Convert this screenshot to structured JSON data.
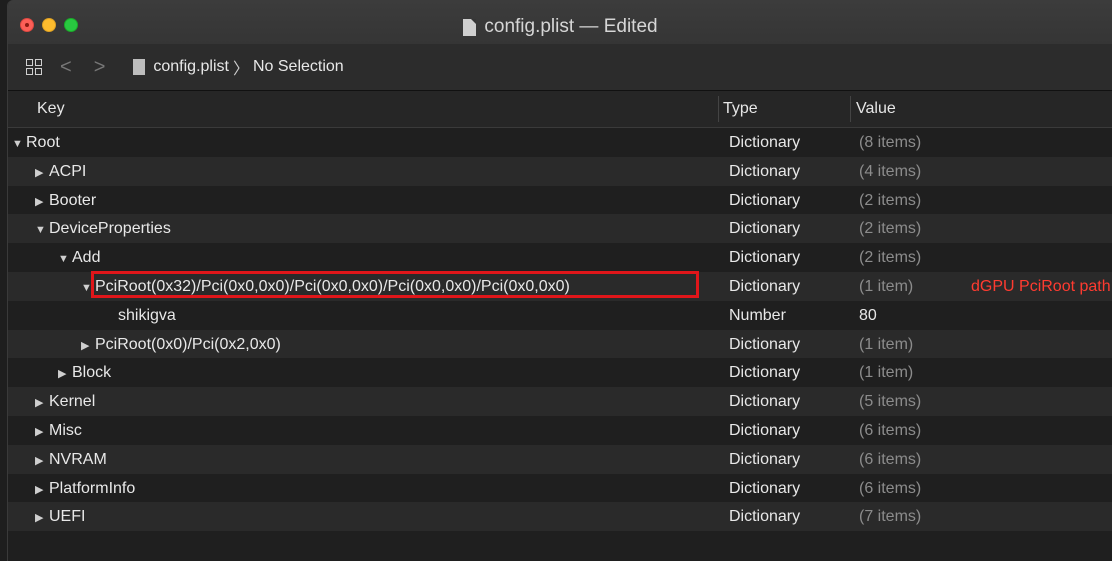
{
  "window": {
    "title": "config.plist — Edited"
  },
  "toolbar": {
    "file": "config.plist",
    "selection": "No Selection",
    "back_glyph": "<",
    "forward_glyph": ">",
    "separator_glyph": "〉"
  },
  "columns": {
    "key": "Key",
    "type": "Type",
    "value": "Value"
  },
  "rows": [
    {
      "key": "Root",
      "expander": "▼",
      "indent": 0,
      "type": "Dictionary",
      "value": "(8 items)"
    },
    {
      "key": "ACPI",
      "expander": "▶",
      "indent": 1,
      "type": "Dictionary",
      "value": "(4 items)"
    },
    {
      "key": "Booter",
      "expander": "▶",
      "indent": 1,
      "type": "Dictionary",
      "value": "(2 items)"
    },
    {
      "key": "DeviceProperties",
      "expander": "▼",
      "indent": 1,
      "type": "Dictionary",
      "value": "(2 items)"
    },
    {
      "key": "Add",
      "expander": "▼",
      "indent": 2,
      "type": "Dictionary",
      "value": "(2 items)"
    },
    {
      "key": "PciRoot(0x32)/Pci(0x0,0x0)/Pci(0x0,0x0)/Pci(0x0,0x0)/Pci(0x0,0x0)",
      "expander": "▼",
      "indent": 3,
      "type": "Dictionary",
      "value": "(1 item)",
      "note": "dGPU PciRoot path"
    },
    {
      "key": "shikigva",
      "expander": "",
      "indent": 4,
      "type": "Number",
      "value": "80",
      "bright": true
    },
    {
      "key": "PciRoot(0x0)/Pci(0x2,0x0)",
      "expander": "▶",
      "indent": 3,
      "type": "Dictionary",
      "value": "(1 item)"
    },
    {
      "key": "Block",
      "expander": "▶",
      "indent": 2,
      "type": "Dictionary",
      "value": "(1 item)"
    },
    {
      "key": "Kernel",
      "expander": "▶",
      "indent": 1,
      "type": "Dictionary",
      "value": "(5 items)"
    },
    {
      "key": "Misc",
      "expander": "▶",
      "indent": 1,
      "type": "Dictionary",
      "value": "(6 items)"
    },
    {
      "key": "NVRAM",
      "expander": "▶",
      "indent": 1,
      "type": "Dictionary",
      "value": "(6 items)"
    },
    {
      "key": "PlatformInfo",
      "expander": "▶",
      "indent": 1,
      "type": "Dictionary",
      "value": "(6 items)"
    },
    {
      "key": "UEFI",
      "expander": "▶",
      "indent": 1,
      "type": "Dictionary",
      "value": "(7 items)"
    }
  ],
  "colors": {
    "annotation": "#e0161a",
    "note_text": "#ff3b30"
  }
}
